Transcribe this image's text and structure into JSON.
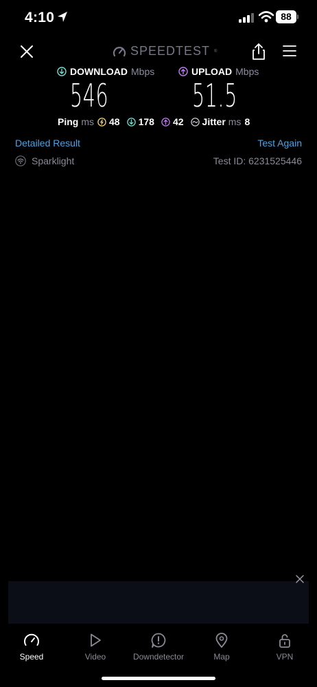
{
  "status_bar": {
    "time": "4:10",
    "battery": "88"
  },
  "header": {
    "logo_text": "SPEEDTEST",
    "logo_tm": "®"
  },
  "download": {
    "label": "DOWNLOAD",
    "unit": "Mbps",
    "value": "546"
  },
  "upload": {
    "label": "UPLOAD",
    "unit": "Mbps",
    "value": "51.5"
  },
  "ping": {
    "label": "Ping",
    "unit": "ms",
    "idle": "48",
    "download": "178",
    "upload": "42",
    "jitter_label": "Jitter",
    "jitter_unit": "ms",
    "jitter": "8"
  },
  "links": {
    "detailed_result": "Detailed Result",
    "test_again": "Test Again"
  },
  "result_info": {
    "isp": "Sparklight",
    "test_id": "Test ID: 6231525446"
  },
  "colors": {
    "accent_blue": "#4aa3e6",
    "download_teal": "#6fe0d2",
    "upload_purple": "#c07cf0",
    "ping_yellow": "#f2d675"
  },
  "tabs": [
    {
      "label": "Speed",
      "icon": "speedometer-icon",
      "active": true
    },
    {
      "label": "Video",
      "icon": "play-icon"
    },
    {
      "label": "Downdetector",
      "icon": "alert-icon"
    },
    {
      "label": "Map",
      "icon": "map-pin-icon"
    },
    {
      "label": "VPN",
      "icon": "lock-icon"
    }
  ]
}
